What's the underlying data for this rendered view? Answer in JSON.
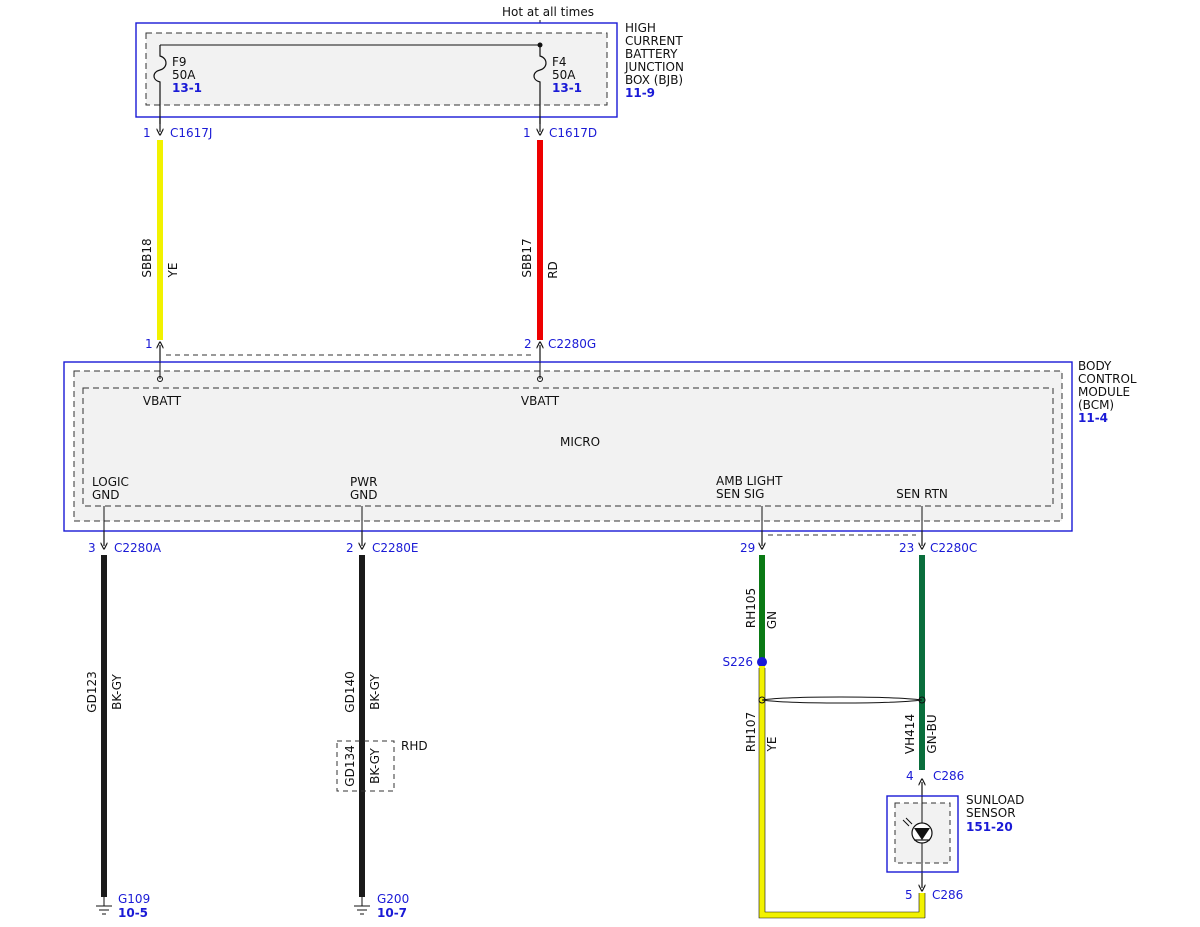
{
  "top_feed": "Hot at all times",
  "bjb": {
    "title_lines": [
      "HIGH",
      "CURRENT",
      "BATTERY",
      "JUNCTION",
      "BOX (BJB)"
    ],
    "ref": "11-9",
    "fuse_left": {
      "id": "F9",
      "rating": "50A",
      "ref": "13-1"
    },
    "fuse_right": {
      "id": "F4",
      "rating": "50A",
      "ref": "13-1"
    }
  },
  "bjb_connectors": {
    "left": {
      "pin": "1",
      "name": "C1617J"
    },
    "right": {
      "pin": "1",
      "name": "C1617D"
    }
  },
  "upper_wires": {
    "left": {
      "circuit": "SBB18",
      "color": "YE",
      "hex": "#f2f200"
    },
    "right": {
      "circuit": "SBB17",
      "color": "RD",
      "hex": "#ee0000"
    }
  },
  "bcm_input_connectors": {
    "left_pin": "1",
    "right_pin": "2",
    "name": "C2280G"
  },
  "bcm": {
    "title_lines": [
      "BODY",
      "CONTROL",
      "MODULE",
      "(BCM)"
    ],
    "ref": "11-4",
    "vbatt_left": "VBATT",
    "vbatt_right": "VBATT",
    "micro": "MICRO",
    "logic_gnd": [
      "LOGIC",
      "GND"
    ],
    "pwr_gnd": [
      "PWR",
      "GND"
    ],
    "amb_light": [
      "AMB LIGHT",
      "SEN SIG"
    ],
    "sen_rtn": "SEN RTN"
  },
  "bcm_output_connectors": [
    {
      "pin": "3",
      "name": "C2280A"
    },
    {
      "pin": "2",
      "name": "C2280E"
    },
    {
      "pin": "29",
      "name": ""
    },
    {
      "pin": "23",
      "name": "C2280C"
    }
  ],
  "lower_wires": {
    "gd123": {
      "circuit": "GD123",
      "color": "BK-GY"
    },
    "gd140": {
      "circuit": "GD140",
      "color": "BK-GY"
    },
    "gd134": {
      "circuit": "GD134",
      "color": "BK-GY",
      "note": "RHD"
    },
    "rh105": {
      "circuit": "RH105",
      "color": "GN",
      "hex": "#0a7a14"
    },
    "rh107": {
      "circuit": "RH107",
      "color": "YE",
      "hex": "#f2f200"
    },
    "vh414": {
      "circuit": "VH414",
      "color": "GN-BU",
      "hex": "#0a6e3c"
    }
  },
  "splice": {
    "name": "S226"
  },
  "sensor_connectors": {
    "top": {
      "pin": "4",
      "name": "C286"
    },
    "bottom": {
      "pin": "5",
      "name": "C286"
    }
  },
  "sunload": {
    "title_lines": [
      "SUNLOAD",
      "SENSOR"
    ],
    "ref": "151-20"
  },
  "grounds": [
    {
      "name": "G109",
      "ref": "10-5"
    },
    {
      "name": "G200",
      "ref": "10-7"
    }
  ]
}
